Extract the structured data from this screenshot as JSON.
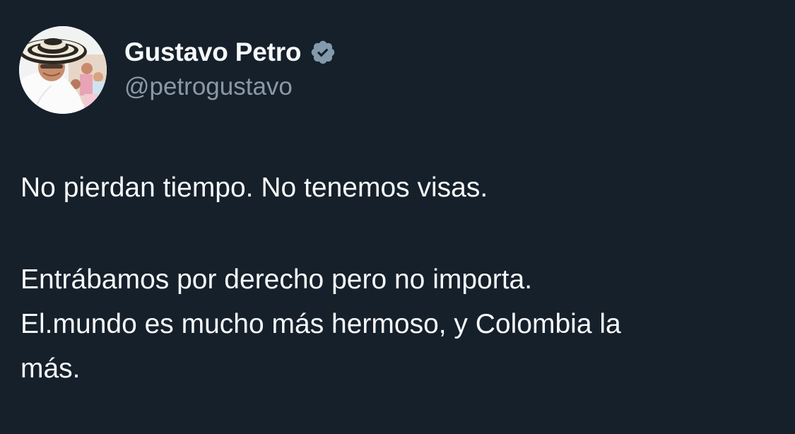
{
  "tweet": {
    "author": {
      "display_name": "Gustavo Petro",
      "handle": "@petrogustavo",
      "verified_icon": "verified-badge-icon",
      "avatar_icon": "profile-avatar"
    },
    "paragraphs": [
      [
        "No pierdan tiempo. No tenemos visas."
      ],
      [
        "Entrábamos por derecho pero no importa.",
        "El.mundo es mucho más hermoso, y Colombia la",
        "más."
      ]
    ]
  },
  "colors": {
    "background": "#15202b",
    "text_primary": "#f7f9f9",
    "text_secondary": "#8b98a5",
    "verified_badge": "#829aab"
  }
}
